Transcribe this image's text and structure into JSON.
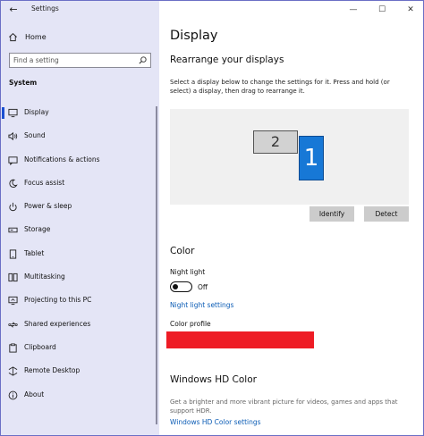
{
  "window": {
    "title": "Settings"
  },
  "sidebar": {
    "home_label": "Home",
    "search_placeholder": "Find a setting",
    "section": "System",
    "items": [
      {
        "label": "Display",
        "icon": "monitor-icon",
        "active": true
      },
      {
        "label": "Sound",
        "icon": "speaker-icon"
      },
      {
        "label": "Notifications & actions",
        "icon": "notification-icon"
      },
      {
        "label": "Focus assist",
        "icon": "moon-icon"
      },
      {
        "label": "Power & sleep",
        "icon": "power-icon"
      },
      {
        "label": "Storage",
        "icon": "storage-icon"
      },
      {
        "label": "Tablet",
        "icon": "tablet-icon"
      },
      {
        "label": "Multitasking",
        "icon": "multitasking-icon"
      },
      {
        "label": "Projecting to this PC",
        "icon": "projecting-icon"
      },
      {
        "label": "Shared experiences",
        "icon": "shared-icon"
      },
      {
        "label": "Clipboard",
        "icon": "clipboard-icon"
      },
      {
        "label": "Remote Desktop",
        "icon": "remote-icon"
      },
      {
        "label": "About",
        "icon": "info-icon"
      }
    ]
  },
  "main": {
    "title": "Display",
    "rearrange": {
      "heading": "Rearrange your displays",
      "description": "Select a display below to change the settings for it. Press and hold (or select) a display, then drag to rearrange it.",
      "monitor_1": "1",
      "monitor_2": "2",
      "identify": "Identify",
      "detect": "Detect"
    },
    "color": {
      "heading": "Color",
      "night_light_label": "Night light",
      "night_light_state": "Off",
      "night_light_link": "Night light settings",
      "profile_label": "Color profile"
    },
    "hd": {
      "heading": "Windows HD Color",
      "description": "Get a brighter and more vibrant picture for videos, games and apps that support HDR.",
      "link": "Windows HD Color settings"
    }
  },
  "colors": {
    "sidebar_bg": "#e4e5f6",
    "accent": "#1a4fd1",
    "link": "#0b5cb5",
    "monitor_1": "#1778d6",
    "redaction": "#ee1c25"
  }
}
